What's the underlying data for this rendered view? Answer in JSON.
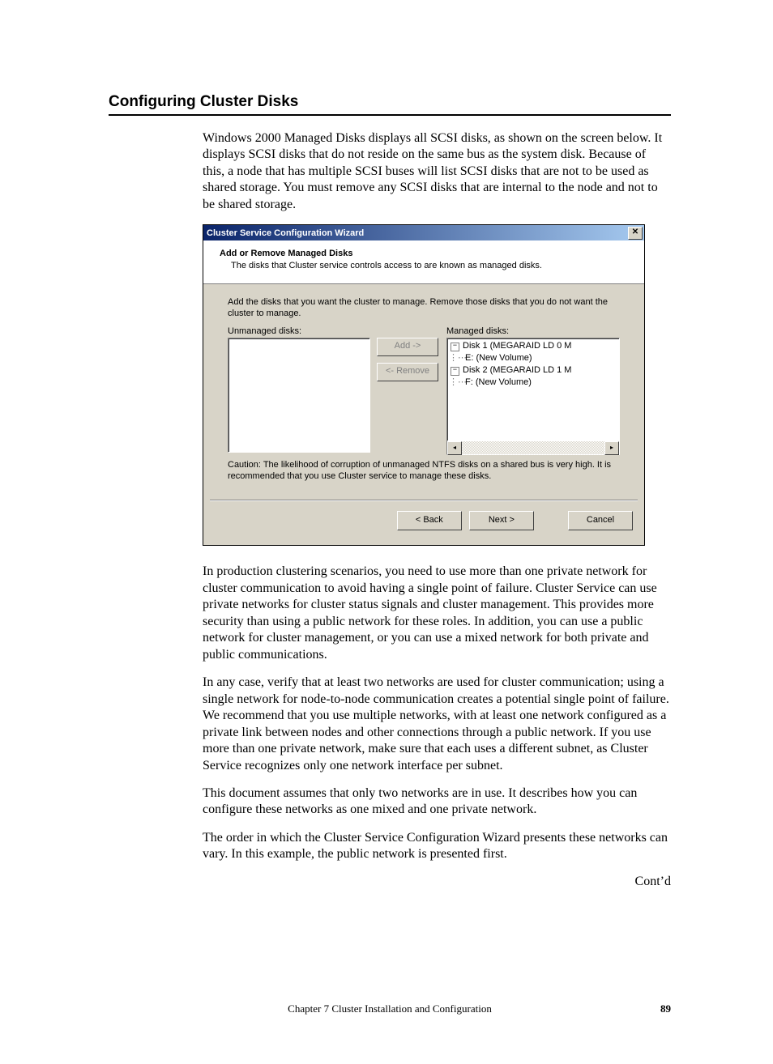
{
  "section_title": "Configuring Cluster Disks",
  "para1": "Windows 2000 Managed Disks displays all SCSI disks, as shown on the screen below.  It displays SCSI disks that do not reside on the same bus as the system disk.  Because of this, a node that has multiple SCSI buses will list SCSI disks that are not to be used as shared storage.  You must remove any SCSI disks that are internal to the node and not to be shared storage.",
  "dialog": {
    "title": "Cluster Service Configuration Wizard",
    "close": "✕",
    "head_title": "Add or Remove Managed Disks",
    "head_sub": "The disks that Cluster service controls access to are known as managed disks.",
    "instruction": "Add the disks that you want the cluster to manage. Remove those disks that you do not want the cluster to manage.",
    "label_unmanaged": "Unmanaged disks:",
    "label_managed": "Managed disks:",
    "btn_add": "Add ->",
    "btn_remove": "<- Remove",
    "tree": {
      "d1": "Disk 1 (MEGARAID LD 0 M",
      "d1v": "E: (New Volume)",
      "d2": "Disk 2 (MEGARAID LD 1 M",
      "d2v": "F: (New Volume)"
    },
    "caution": "Caution: The likelihood of corruption of unmanaged NTFS disks on a shared bus is very high. It is recommended that you use Cluster service to manage these disks.",
    "btn_back": "< Back",
    "btn_next": "Next >",
    "btn_cancel": "Cancel",
    "scroll_left": "◂",
    "scroll_right": "▸",
    "minus": "−"
  },
  "para2": "In production clustering scenarios, you need to use more than one private network for cluster communication to avoid having a single point of failure. Cluster Service can use private networks for cluster status signals and cluster management. This provides more security than using a public network for these roles. In addition, you can use a public network for cluster management, or you can use a mixed network for both private and public communications.",
  "para3": "In any case, verify that at least two networks are used for cluster communication; using a single network for node-to-node communication creates a potential single point of failure. We recommend that you use multiple networks, with at least one network configured as a private link between nodes and other connections through a public network. If you use more than one private network, make sure that each uses a different subnet, as Cluster Service recognizes only one network interface per subnet.",
  "para4": "This document assumes that only two networks are in use. It describes how you can configure these networks as one mixed and one private network.",
  "para5": "The order in which the Cluster Service Configuration Wizard presents these networks can vary. In this example, the public network is presented first.",
  "contd": "Cont’d",
  "footer_center": "Chapter 7 Cluster Installation and Configuration",
  "footer_page": "89"
}
